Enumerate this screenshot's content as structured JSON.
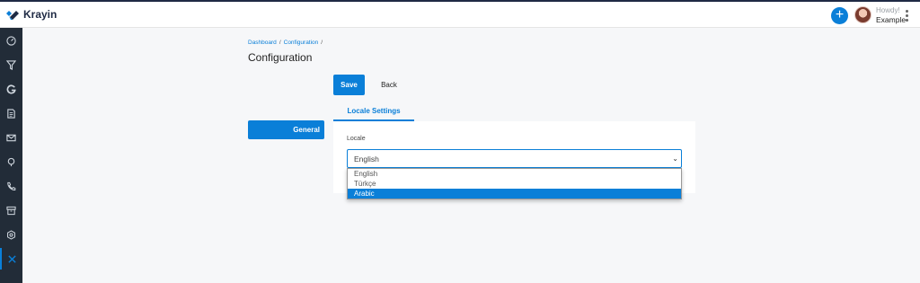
{
  "app": {
    "name": "Krayin"
  },
  "header": {
    "greeting": "Howdy!",
    "user_name": "Example",
    "add_symbol": "+"
  },
  "sidebar": {
    "items": [
      {
        "icon": "dashboard-icon"
      },
      {
        "icon": "filter-icon"
      },
      {
        "icon": "g-icon"
      },
      {
        "icon": "document-icon"
      },
      {
        "icon": "mail-icon"
      },
      {
        "icon": "activity-icon"
      },
      {
        "icon": "phone-icon"
      },
      {
        "icon": "archive-icon"
      },
      {
        "icon": "settings-icon"
      },
      {
        "icon": "tools-icon",
        "active": true
      }
    ]
  },
  "breadcrumb": {
    "items": [
      "Dashboard",
      "Configuration"
    ],
    "separator": "/"
  },
  "page": {
    "title": "Configuration"
  },
  "actions": {
    "save": "Save",
    "back": "Back"
  },
  "nav": {
    "general": "General"
  },
  "tabs": {
    "locale_settings": "Locale Settings"
  },
  "form": {
    "locale_label": "Locale",
    "selected": "English",
    "options": [
      "English",
      "Türkçe",
      "Arabic"
    ],
    "highlighted": "Arabic"
  },
  "colors": {
    "accent": "#0a7fd8",
    "sidebar": "#222c38"
  }
}
